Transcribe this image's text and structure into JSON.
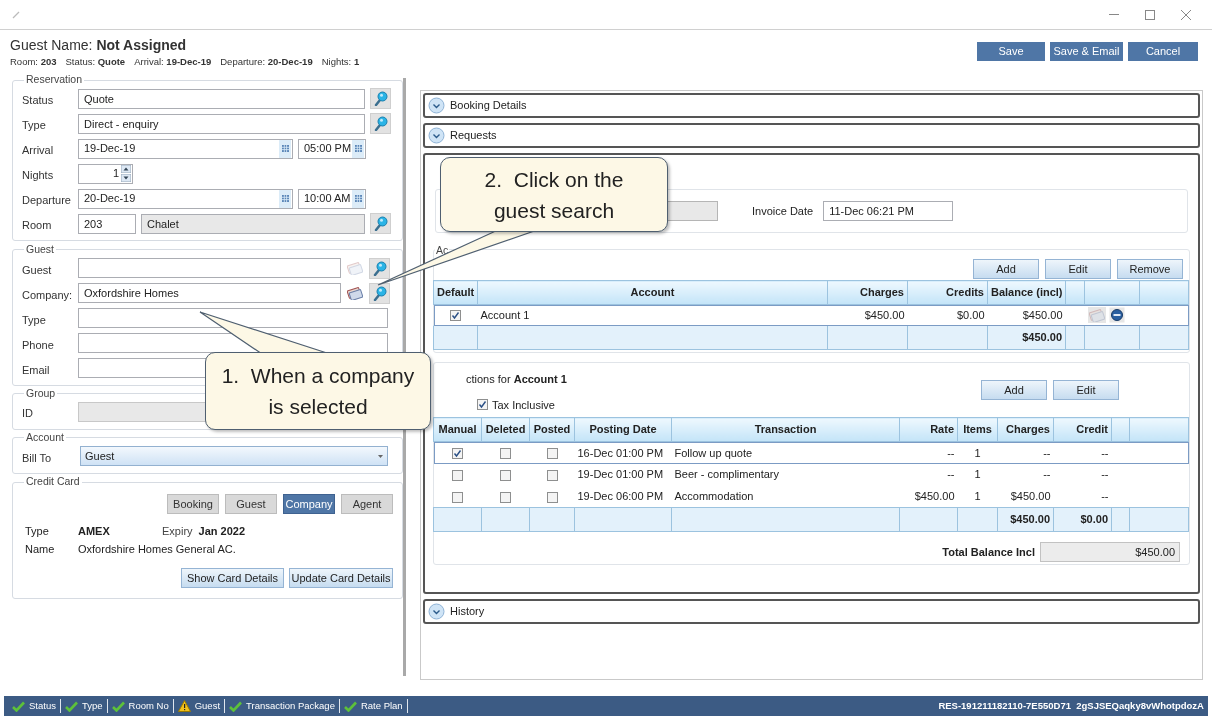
{
  "header": {
    "guest_name": "Guest Name: **Not Assigned**",
    "summary": [
      "Room: **203**",
      "Status: **Quote**",
      "Arrival: **19-Dec-19**",
      "Departure: **20-Dec-19**",
      "Nights: **1**"
    ]
  },
  "actions": [
    "Save",
    "Save & Email",
    "Cancel"
  ],
  "reservation": {
    "title": "Reservation",
    "fields": [
      {
        "kind": "lookup",
        "label": "Status",
        "value": "Quote"
      },
      {
        "kind": "lookup",
        "label": "Type",
        "value": "Direct - enquiry"
      },
      {
        "kind": "datetime",
        "label": "Arrival",
        "value": "19-Dec-19",
        "time": "05:00 PM"
      },
      {
        "kind": "spinner",
        "label": "Nights",
        "value": "1"
      },
      {
        "kind": "datetime",
        "label": "Departure",
        "value": "20-Dec-19",
        "time": "10:00 AM"
      },
      {
        "kind": "room",
        "label": "Room",
        "value": "203",
        "room_type": "Chalet"
      }
    ]
  },
  "guest": {
    "title": "Guest",
    "fields": [
      {
        "kind": "lookup",
        "label": "Guest",
        "card_enabled": false
      },
      {
        "kind": "lookup",
        "label": "Company:",
        "value": "Oxfordshire Homes",
        "card_enabled": true
      },
      {
        "kind": "text",
        "label": "Type"
      },
      {
        "kind": "text",
        "label": "Phone"
      },
      {
        "kind": "text",
        "label": "Email"
      }
    ]
  },
  "group": {
    "title": "Group",
    "id_label": "ID"
  },
  "account": {
    "title": "Account",
    "bill_to_label": "Bill To",
    "bill_to": "Guest"
  },
  "credit_card": {
    "title": "Credit Card",
    "tabs": [
      {
        "label": "Booking",
        "selected": false
      },
      {
        "label": "Guest",
        "selected": false
      },
      {
        "label": "Company",
        "selected": true
      },
      {
        "label": "Agent",
        "selected": false
      }
    ],
    "type_label": "Type",
    "type": "AMEX",
    "expiry_label": "Expiry",
    "expiry": "Jan 2022",
    "name_label": "Name",
    "name": "Oxfordshire Homes General AC.",
    "buttons": [
      "Show Card Details",
      "Update Card Details"
    ]
  },
  "sections_top": [
    "Booking Details",
    "Requests"
  ],
  "invoice": {
    "date_label": "Invoice Date",
    "date": "11-Dec 06:21 PM"
  },
  "accounts": {
    "title": "Ac",
    "buttons": [
      "Add",
      "Edit",
      "Remove"
    ],
    "columns": [
      "Default",
      "Account",
      "Charges",
      "Credits",
      "Balance (incl)"
    ],
    "rows": [
      {
        "default": true,
        "account": "Account 1",
        "charges": "$450.00",
        "credits": "$0.00",
        "balance": "$450.00",
        "selected": true
      }
    ],
    "total_balance": "$450.00"
  },
  "transactions": {
    "title": "ctions for **Account 1**",
    "tax_inclusive": {
      "label": "Tax Inclusive",
      "checked": true
    },
    "buttons": [
      "Add",
      "Edit"
    ],
    "columns": [
      "Manual",
      "Deleted",
      "Posted",
      "Posting Date",
      "Transaction",
      "Rate",
      "Items",
      "Charges",
      "Credit"
    ],
    "rows": [
      {
        "manual": true,
        "deleted": false,
        "posted": false,
        "posting_date": "16-Dec 01:00 PM",
        "transaction": "Follow up quote",
        "rate": "--",
        "items": "1",
        "charges": "--",
        "credit": "--",
        "selected": true
      },
      {
        "manual": false,
        "deleted": false,
        "posted": false,
        "posting_date": "19-Dec 01:00 PM",
        "transaction": "Beer - complimentary",
        "rate": "--",
        "items": "1",
        "charges": "--",
        "credit": "--",
        "selected": false
      },
      {
        "manual": false,
        "deleted": false,
        "posted": false,
        "posting_date": "19-Dec 06:00 PM",
        "transaction": "Accommodation",
        "rate": "$450.00",
        "items": "1",
        "charges": "$450.00",
        "credit": "--",
        "selected": false
      }
    ],
    "totals": {
      "charges": "$450.00",
      "credit": "$0.00"
    },
    "total_balance_label": "Total Balance Incl",
    "total_balance": "$450.00"
  },
  "sections_bottom": [
    "History"
  ],
  "status_bar": {
    "items": [
      {
        "label": "Status",
        "kind": "ok"
      },
      {
        "label": "Type",
        "kind": "ok"
      },
      {
        "label": "Room No",
        "kind": "ok"
      },
      {
        "label": "Guest",
        "kind": "warning"
      },
      {
        "label": "Transaction Package",
        "kind": "ok"
      },
      {
        "label": "Rate Plan",
        "kind": "ok"
      }
    ],
    "reference": "RES-191211182110-7E550D71  2gSJSEQaqky8vWhotpdozA"
  },
  "callouts": [
    {
      "lines": [
        "1.  When a company",
        "is selected"
      ]
    },
    {
      "lines": [
        "2.  Click on the",
        "guest search"
      ]
    }
  ]
}
